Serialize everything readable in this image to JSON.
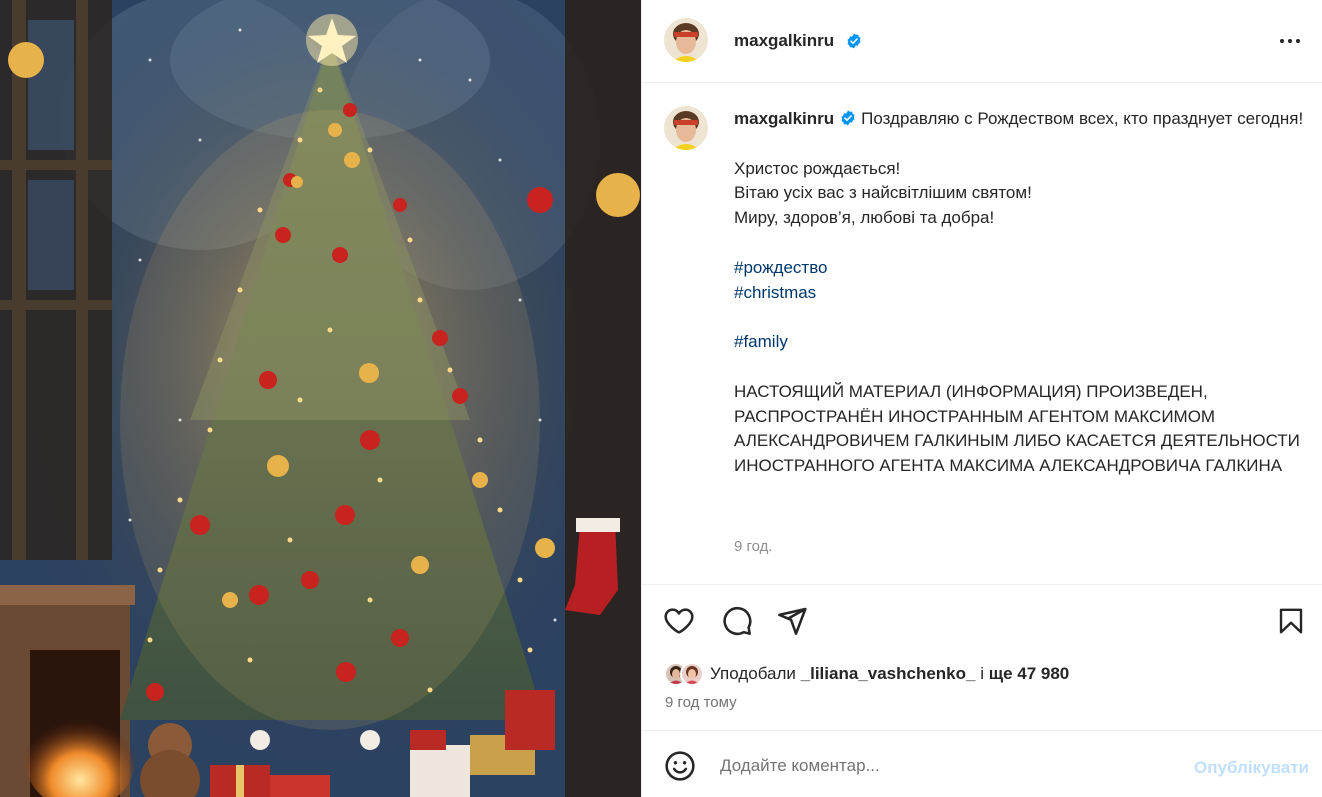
{
  "colors": {
    "text": "#262626",
    "secondary": "#737373",
    "hashtag": "#00376b",
    "verified": "#0095f6",
    "post_disabled": "#c0dffd",
    "divider": "#efefef"
  },
  "media": {
    "icon": "christmas-tree-image"
  },
  "header": {
    "username": "maxgalkinru",
    "verified_icon": "verified-badge-icon",
    "more_icon": "more-options-icon"
  },
  "caption": {
    "username": "maxgalkinru",
    "first_line": "Поздравляю с Рождеством всех, кто празднует сегодня!",
    "ua_lines": [
      "Христос рождається!",
      "Вітаю усіх вас з найсвітлішим святом!",
      "Миру, здоров’я, любові та добра!"
    ],
    "hashtags": [
      "#рождество",
      "#christmas"
    ],
    "hashtag_family": "#family",
    "disclaimer": "НАСТОЯЩИЙ МАТЕРИАЛ (ИНФОРМАЦИЯ) ПРОИЗВЕДЕН, РАСПРОСТРАНЁН ИНОСТРАННЫМ АГЕНТОМ МАКСИМОМ АЛЕКСАНДРОВИЧЕМ ГАЛКИНЫМ ЛИБО КАСАЕТСЯ ДЕЯТЕЛЬНОСТИ ИНОСТРАННОГО АГЕНТА МАКСИМА АЛЕКСАНДРОВИЧА ГАЛКИНА",
    "time": "9 год."
  },
  "actions": {
    "like_icon": "heart-icon",
    "comment_icon": "comment-icon",
    "share_icon": "share-icon",
    "save_icon": "bookmark-icon"
  },
  "likes": {
    "prefix": "Уподобали",
    "user": "_liliana_vashchenko_",
    "mid": "і",
    "rest": "ще 47 980"
  },
  "posted_ago": "9 год тому",
  "comment": {
    "emoji_icon": "emoji-icon",
    "placeholder": "Додайте коментар...",
    "post_label": "Опублікувати"
  }
}
